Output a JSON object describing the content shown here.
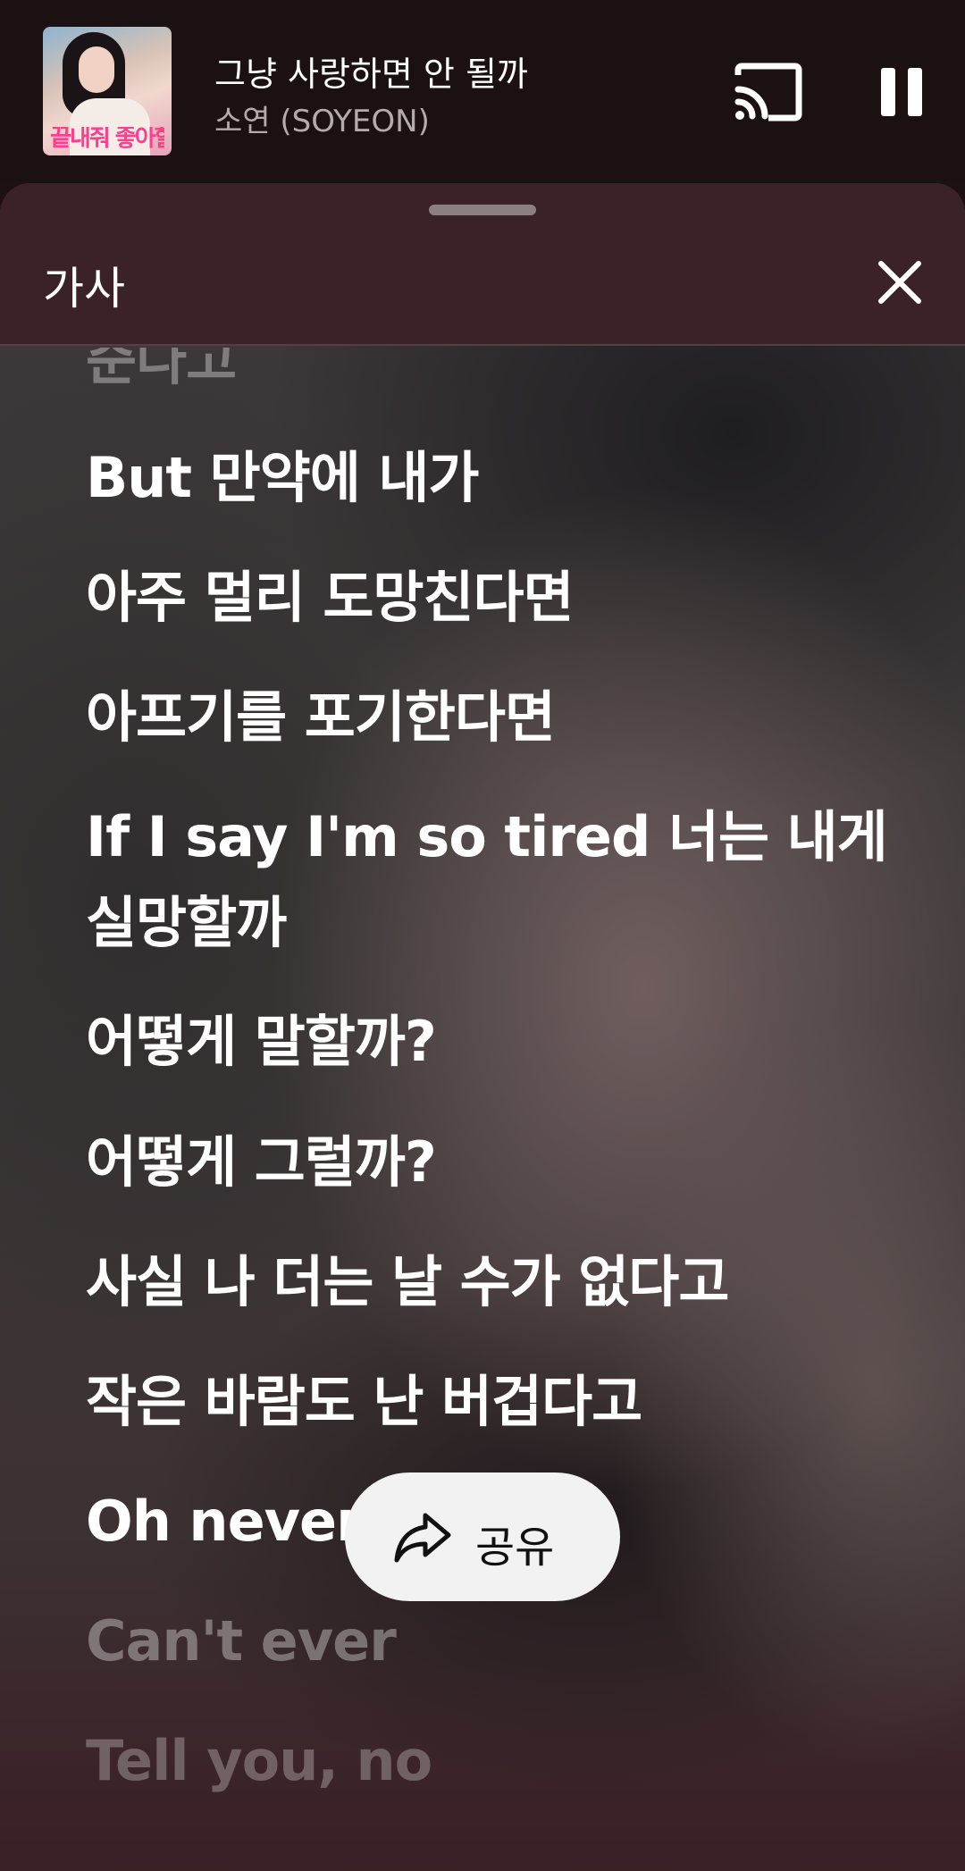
{
  "mini_player": {
    "title": "그냥 사랑하면 안 될까",
    "artist": "소연 (SOYEON)",
    "album_art_text": "끝내줘 좋아할게",
    "cast_icon": "cast-icon",
    "pause_icon": "pause-icon"
  },
  "sheet": {
    "title": "가사",
    "close_icon": "close-icon"
  },
  "lyrics": [
    "준다고",
    "But 만약에 내가",
    "아주 멀리 도망친다면",
    "아프기를 포기한다면",
    "If I say I'm so tired 너는 내게 실망할까",
    "어떻게 말할까?",
    "어떻게 그럴까?",
    "사실 나 더는 날 수가 없다고",
    "작은 바람도 난 버겁다고",
    "Oh never",
    "Can't ever",
    "Tell you, no"
  ],
  "share": {
    "label": "공유",
    "icon": "share-icon"
  }
}
